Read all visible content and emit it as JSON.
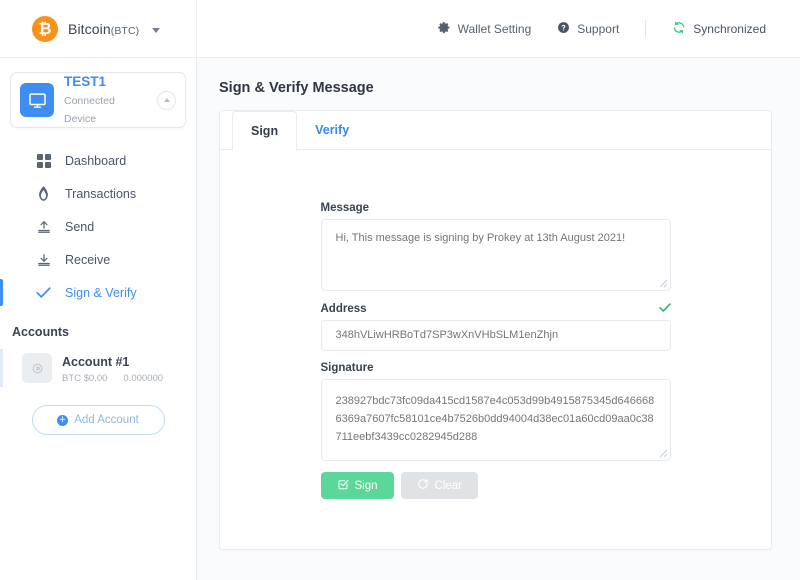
{
  "sidebar": {
    "brand": {
      "name": "Bitcoin",
      "ticker": "(BTC)",
      "logo_glyph": "₿",
      "logo_color": "#f7931a"
    },
    "device": {
      "name": "TEST1",
      "status": "Connected Device"
    },
    "nav": [
      {
        "label": "Dashboard",
        "icon": "grid-icon",
        "active": false
      },
      {
        "label": "Transactions",
        "icon": "flame-icon",
        "active": false
      },
      {
        "label": "Send",
        "icon": "upload-icon",
        "active": false
      },
      {
        "label": "Receive",
        "icon": "download-icon",
        "active": false
      },
      {
        "label": "Sign & Verify",
        "icon": "check-icon",
        "active": true
      }
    ],
    "accounts_heading": "Accounts",
    "accounts": [
      {
        "name": "Account #1",
        "fiat": "BTC $0.00",
        "amount": "0.000000"
      }
    ],
    "add_account_label": "Add Account"
  },
  "topbar": {
    "wallet_setting": "Wallet Setting",
    "support": "Support",
    "sync_status": "Synchronized",
    "sync_color": "#2bcc82"
  },
  "main": {
    "page_title": "Sign & Verify Message",
    "tabs": [
      {
        "label": "Sign",
        "active": true
      },
      {
        "label": "Verify",
        "active": false
      }
    ],
    "form": {
      "message_label": "Message",
      "message_placeholder": "Hi, This message is signing by Prokey at 13th August 2021!",
      "message_value": "",
      "address_label": "Address",
      "address_placeholder": "348hVLiwHRBoTd7SP3wXnVHbSLM1enZhjn",
      "address_value": "",
      "address_valid": true,
      "signature_label": "Signature",
      "signature_placeholder": "238927bdc73fc09da415cd1587e4c053d99b4915875345d6466686369a7607fc58101ce4b7526b0dd94004d38ec01a60cd09aa0c38711eebf3439cc0282945d288",
      "signature_value": "",
      "sign_button": "Sign",
      "clear_button": "Clear"
    }
  }
}
